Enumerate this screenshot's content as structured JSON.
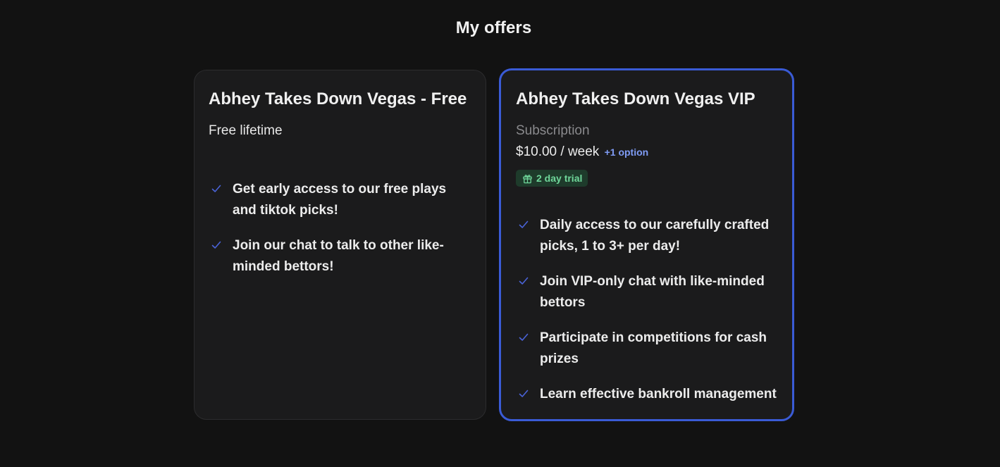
{
  "page": {
    "title": "My offers"
  },
  "colors": {
    "background": "#121212",
    "card": "#1b1b1c",
    "accent_border": "#3a5bd6",
    "check": "#4a63d8",
    "link": "#7f9cf5",
    "trial_badge_bg": "#1e3b2b",
    "trial_badge_text": "#6fd69a"
  },
  "offers": [
    {
      "title": "Abhey Takes Down Vegas - Free",
      "price_type": "Free lifetime",
      "features": [
        "Get early access to our free plays and tiktok picks!",
        "Join our chat to talk to other like-minded bettors!"
      ]
    },
    {
      "title": "Abhey Takes Down Vegas VIP",
      "price_type": "Subscription",
      "price": "$10.00 / week",
      "more_options": "+1 option",
      "trial": "2 day trial",
      "trial_icon": "gift-icon",
      "features": [
        "Daily access to our carefully crafted picks, 1 to 3+ per day!",
        "Join VIP-only chat with like-minded bettors",
        "Participate in competitions for cash prizes",
        "Learn effective bankroll management"
      ]
    }
  ]
}
